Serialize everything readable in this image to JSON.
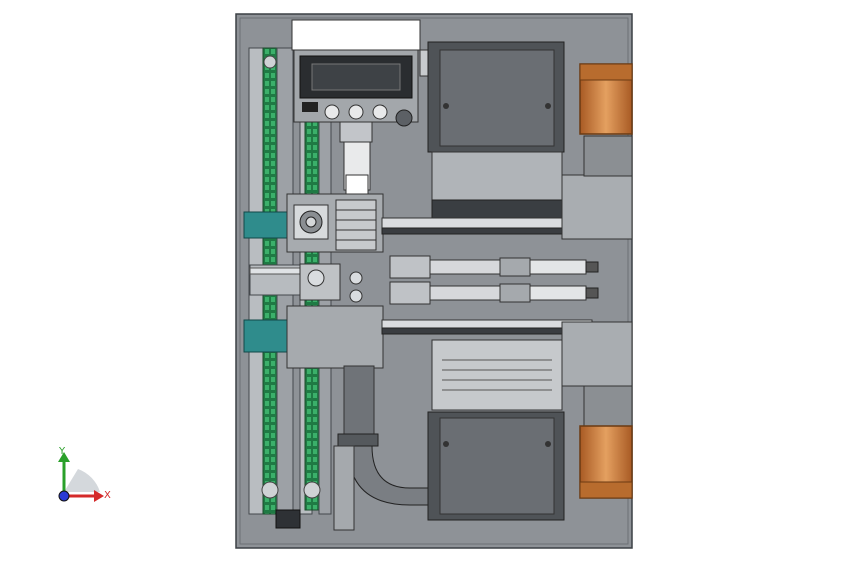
{
  "viewport": {
    "background": "#ffffff"
  },
  "model": {
    "base_plate_color": "#8d9196",
    "frame_color": "#5e6368",
    "belt_color": "#2e9a5c",
    "accent_teal": "#2f8c8c",
    "motor_copper": "#c87a3a",
    "display_text": ""
  },
  "triad": {
    "x_label": "X",
    "y_label": "Y",
    "x_color": "#d42a2a",
    "y_color": "#2aa02a",
    "z_color": "#2a3ad4"
  }
}
